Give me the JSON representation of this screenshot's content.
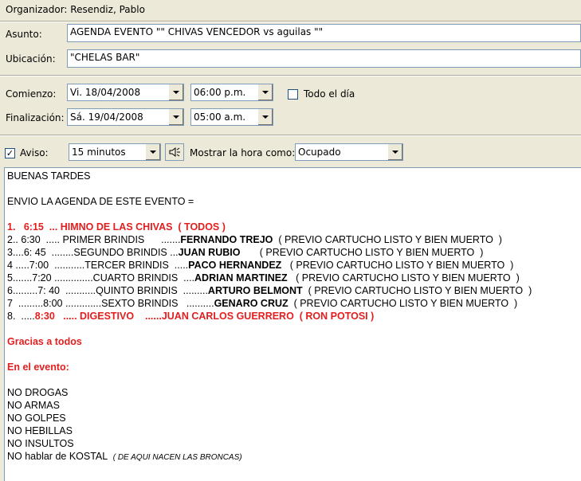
{
  "organizer": "Organizador: Resendiz, Pablo",
  "subject": {
    "label": "Asunto:",
    "value": "AGENDA EVENTO  \"\" CHIVAS VENCEDOR    vs aguilas  \"\""
  },
  "location": {
    "label": "Ubicación:",
    "value": "\"CHELAS BAR\""
  },
  "start": {
    "label": "Comienzo:",
    "date": "Vi. 18/04/2008",
    "time": "06:00 p.m."
  },
  "all_day": {
    "label": "Todo el día",
    "checked": false
  },
  "end": {
    "label": "Finalización:",
    "date": "Sá. 19/04/2008",
    "time": "05:00 a.m."
  },
  "reminder": {
    "label": "Aviso:",
    "checked": true,
    "value": "15 minutos"
  },
  "show_as": {
    "label": "Mostrar la hora como:",
    "value": "Ocupado"
  },
  "body": {
    "greeting": "BUENAS TARDES",
    "intro": "ENVIO LA AGENDA DE ESTE EVENTO =",
    "item1_num": "1.   ",
    "item1_text": "6:15  ... HIMNO DE LAS CHIVAS  ( TODOS )",
    "item2_pre": "2.. 6:30  ..... PRIMER BRINDIS      .......",
    "item2_name": "FERNANDO TREJO",
    "item2_post": "  ( PREVIO CARTUCHO LISTO Y BIEN MUERTO  )",
    "item3_pre": "3....6: 45  ........SEGUNDO BRINDIS ...",
    "item3_name": "JUAN RUBIO",
    "item3_post": "       ( PREVIO CARTUCHO LISTO Y BIEN MUERTO  )",
    "item4_pre": "4 .....7:00  ...........TERCER BRINDIS  .....",
    "item4_name": "PACO HERNANDEZ",
    "item4_post": "   ( PREVIO CARTUCHO LISTO Y BIEN MUERTO  )",
    "item5_pre": "5.......7:20 ..............CUARTO BRINDIS  ....",
    "item5_name": "ADRIAN MARTINEZ",
    "item5_post": "   ( PREVIO CARTUCHO LISTO Y BIEN MUERTO  )",
    "item6_pre": "6.........7: 40  ...........QUINTO BRINDIS  .........",
    "item6_name": "ARTURO BELMONT",
    "item6_post": "  ( PREVIO CARTUCHO LISTO Y BIEN MUERTO  )",
    "item7_pre": "7  .........8:00 .............SEXTO BRINDIS   ..........",
    "item7_name": "GENARO CRUZ",
    "item7_post": "  ( PREVIO CARTUCHO LISTO Y BIEN MUERTO  )",
    "item8_num": "8.  .....",
    "item8_text": "8:30   ..... DIGESTIVO    ......JUAN CARLOS GUERRERO  ( RON POTOSI )",
    "thanks": "Gracias a todos",
    "at_event": "En el evento:",
    "rules": [
      "NO DROGAS",
      "NO ARMAS",
      "NO GOLPES",
      "NO HEBILLAS",
      "NO INSULTOS"
    ],
    "last_rule": "NO hablar de KOSTAL",
    "last_rule_note": "( DE AQUI NACEN LAS BRONCAS)"
  }
}
